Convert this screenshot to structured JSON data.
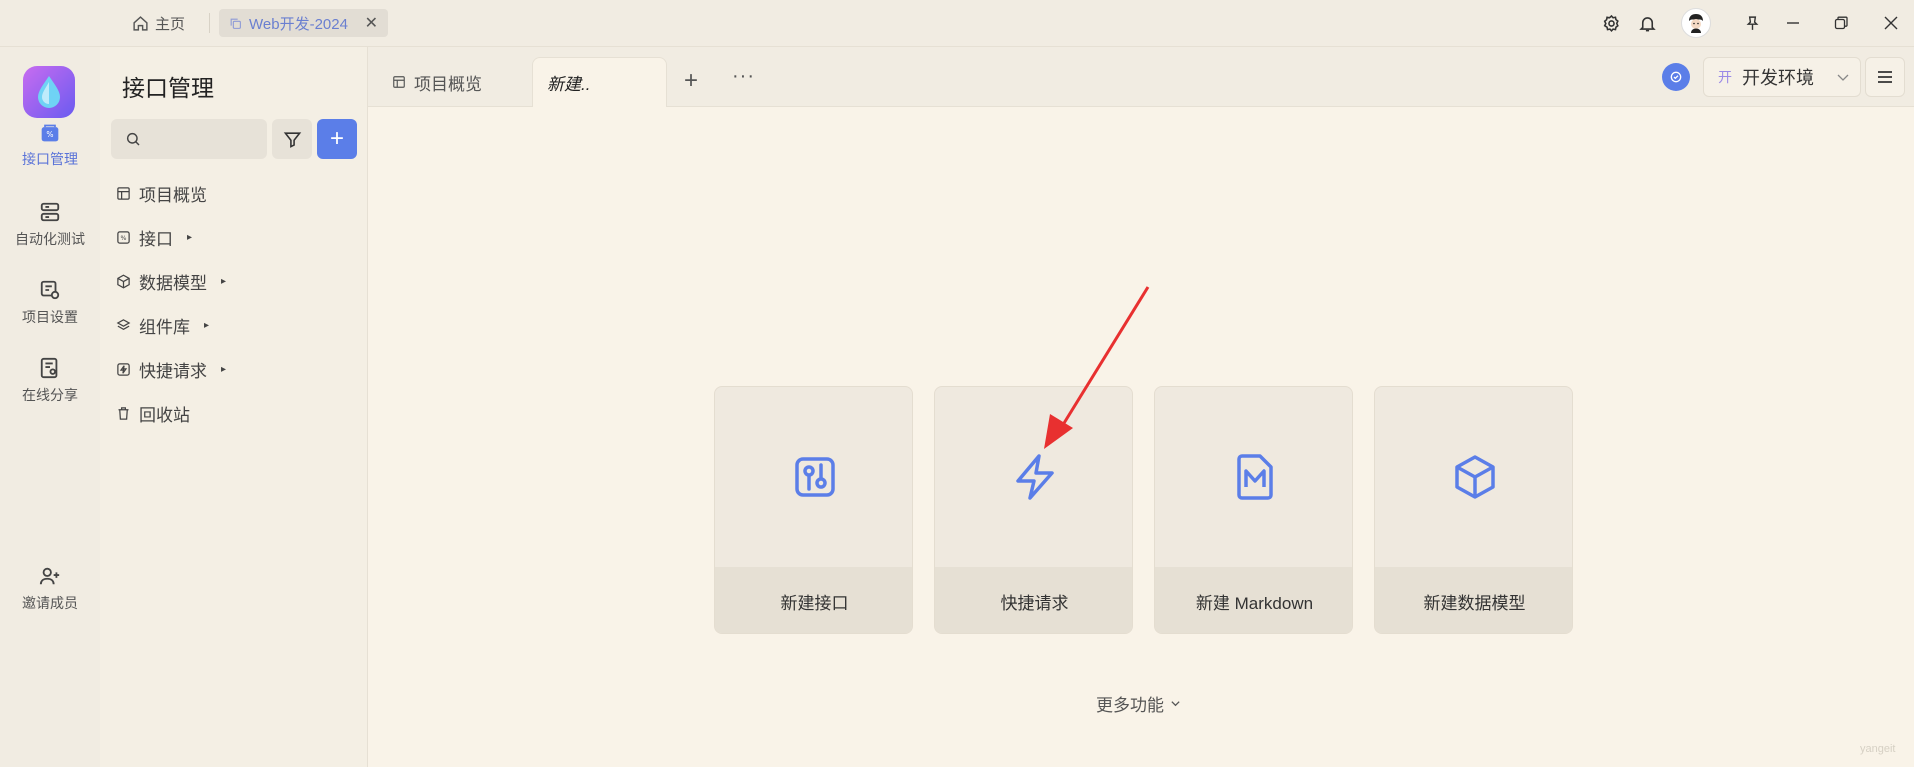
{
  "titlebar": {
    "home_label": "主页",
    "tab_label": "Web开发-2024",
    "close_glyph": "✕"
  },
  "rail": {
    "items": [
      {
        "label": "接口管理",
        "icon": "api-icon",
        "active": true
      },
      {
        "label": "自动化测试",
        "icon": "automation-icon"
      },
      {
        "label": "项目设置",
        "icon": "project-settings-icon"
      },
      {
        "label": "在线分享",
        "icon": "share-icon"
      },
      {
        "label": "邀请成员",
        "icon": "invite-user-icon"
      }
    ]
  },
  "sidebar": {
    "title": "接口管理",
    "search_placeholder": "",
    "add_glyph": "+",
    "nav": [
      {
        "label": "项目概览",
        "icon": "overview-icon"
      },
      {
        "label": "接口",
        "icon": "api-icon",
        "has_children": true
      },
      {
        "label": "数据模型",
        "icon": "cube-icon",
        "has_children": true
      },
      {
        "label": "组件库",
        "icon": "layers-icon",
        "has_children": true
      },
      {
        "label": "快捷请求",
        "icon": "bolt-icon",
        "has_children": true
      },
      {
        "label": "回收站",
        "icon": "trash-icon"
      }
    ]
  },
  "tabs": {
    "items": [
      {
        "label": "项目概览"
      },
      {
        "label": "新建..",
        "active": true
      }
    ],
    "plus_glyph": "+",
    "more_glyph": "···"
  },
  "environment": {
    "badge": "开",
    "label": "开发环境"
  },
  "cards": [
    {
      "label": "新建接口",
      "icon": "api-icon"
    },
    {
      "label": "快捷请求",
      "icon": "bolt-icon"
    },
    {
      "label": "新建 Markdown",
      "icon": "markdown-icon"
    },
    {
      "label": "新建数据模型",
      "icon": "cube-icon"
    }
  ],
  "more_features": "更多功能",
  "watermark": "yangeit",
  "colors": {
    "accent": "#5b7ee8",
    "arrow": "#e83030"
  }
}
